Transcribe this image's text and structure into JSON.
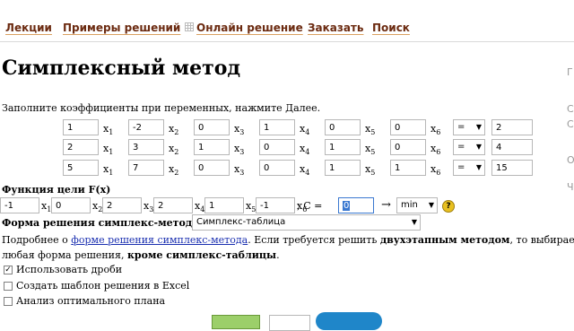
{
  "nav": {
    "items": [
      "Лекции",
      "Примеры решений",
      "Онлайн решение",
      "Заказать",
      "Поиск"
    ]
  },
  "page_title": "Симплексный метод",
  "instruction": "Заполните коэффициенты при переменных, нажмите Далее.",
  "constraints": [
    {
      "coef": [
        "1",
        "-2",
        "0",
        "1",
        "0",
        "0"
      ],
      "sign": "=",
      "rhs": "2"
    },
    {
      "coef": [
        "2",
        "3",
        "1",
        "0",
        "1",
        "0"
      ],
      "sign": "=",
      "rhs": "4"
    },
    {
      "coef": [
        "5",
        "7",
        "0",
        "0",
        "1",
        "1"
      ],
      "sign": "=",
      "rhs": "15"
    }
  ],
  "var_labels": [
    "x",
    "x",
    "x",
    "x",
    "x",
    "x"
  ],
  "var_indices": [
    "1",
    "2",
    "3",
    "4",
    "5",
    "6"
  ],
  "objective": {
    "label": "Функция цели F(x)",
    "coef": [
      "-1",
      "0",
      "2",
      "2",
      "1",
      "-1"
    ],
    "c_label": "; C =",
    "c_value": "0",
    "arrow": "→",
    "direction": "min"
  },
  "form": {
    "label": "Форма решения симплекс-метода",
    "selected": "Симплекс-таблица"
  },
  "info": {
    "prefix": "Подробнее о ",
    "link": "форме решения симплекс-метода",
    "middle": ". Если требуется решить ",
    "bold1": "двухэтапным методом",
    "suffix": ", то выбирает",
    "line2_prefix": "любая форма решения, ",
    "bold2": "кроме симплекс-таблицы",
    "line2_suffix": "."
  },
  "options": [
    {
      "label": "Использовать дроби",
      "checked": true
    },
    {
      "label": "Создать шаблон решения в Excel",
      "checked": false
    },
    {
      "label": "Анализ оптимального плана",
      "checked": false
    }
  ],
  "help_icon": "question-icon",
  "right_edge_glyphs": [
    "Г",
    "С",
    "С",
    "О",
    "Ч"
  ]
}
